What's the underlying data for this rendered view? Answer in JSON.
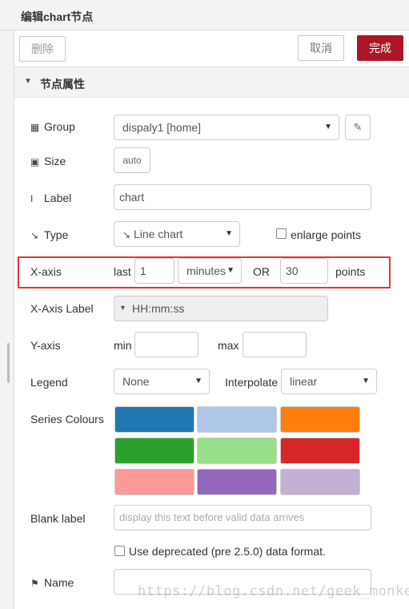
{
  "window": {
    "title": "编辑chart节点"
  },
  "toolbar": {
    "delete_label": "删除",
    "cancel_label": "取消",
    "done_label": "完成",
    "done_color": "#ad1625"
  },
  "section": {
    "title": "节点属性"
  },
  "form": {
    "group": {
      "label": "Group",
      "icon": "table-icon",
      "value": "dispaly1 [home]"
    },
    "size": {
      "label": "Size",
      "icon": "size-icon",
      "value": "auto"
    },
    "label": {
      "label": "Label",
      "icon": "i-cursor-icon",
      "value": "chart"
    },
    "type": {
      "label": "Type",
      "icon": "line-chart-icon",
      "value": "Line chart",
      "enlarge_label": "enlarge points"
    },
    "xaxis": {
      "label": "X-axis",
      "last_label": "last",
      "amount": "1",
      "unit": "minutes",
      "or_label": "OR",
      "points_value": "30",
      "points_label": "points"
    },
    "xaxis_label": {
      "label": "X-Axis Label",
      "value": "HH:mm:ss"
    },
    "yaxis": {
      "label": "Y-axis",
      "min_label": "min",
      "min_value": "",
      "max_label": "max",
      "max_value": ""
    },
    "legend": {
      "label": "Legend",
      "value": "None",
      "interpolate_label": "Interpolate",
      "interpolate_value": "linear"
    },
    "series": {
      "label": "Series Colours",
      "colors": [
        "#1f77b4",
        "#aec7e8",
        "#ff7f0e",
        "#2ca02c",
        "#98df8a",
        "#d62728",
        "#ff9896",
        "#9467bd",
        "#c5b0d5"
      ]
    },
    "blank": {
      "label": "Blank label",
      "placeholder": "display this text before valid data arrives"
    },
    "deprecated": {
      "label": "Use deprecated (pre 2.5.0) data format."
    },
    "name": {
      "label": "Name",
      "icon": "tag-icon",
      "value": ""
    }
  },
  "highlight_color": "#e0353b",
  "watermark": "https://blog.csdn.net/geek_monkey"
}
